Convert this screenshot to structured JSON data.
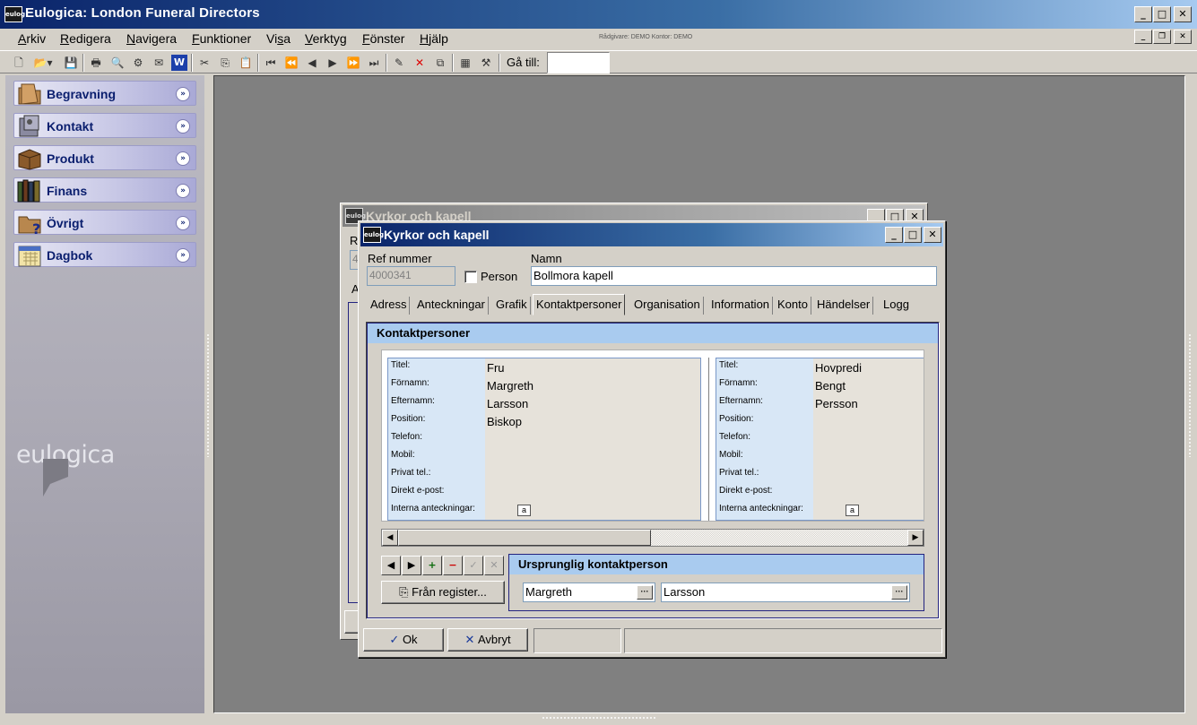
{
  "app": {
    "title": "Eulogica: London Funeral Directors",
    "icon": "eulogica-app-icon",
    "icon_text": "eulog"
  },
  "menu": {
    "items": [
      {
        "pre": "",
        "u": "A",
        "post": "rkiv"
      },
      {
        "pre": "",
        "u": "R",
        "post": "edigera"
      },
      {
        "pre": "",
        "u": "N",
        "post": "avigera"
      },
      {
        "pre": "",
        "u": "F",
        "post": "unktioner"
      },
      {
        "pre": "Vi",
        "u": "s",
        "post": "a"
      },
      {
        "pre": "",
        "u": "V",
        "post": "erktyg"
      },
      {
        "pre": "",
        "u": "F",
        "post": "önster"
      },
      {
        "pre": "",
        "u": "H",
        "post": "jälp"
      }
    ],
    "info": "Rådgivare: DEMO   Kontor: DEMO"
  },
  "toolbar": {
    "goto_label": "Gå till:",
    "goto_value": ""
  },
  "sidebar": {
    "items": [
      {
        "label": "Begravning",
        "icon": "folder-icon"
      },
      {
        "label": "Kontakt",
        "icon": "contact-card-icon"
      },
      {
        "label": "Produkt",
        "icon": "box-icon"
      },
      {
        "label": "Finans",
        "icon": "ledger-books-icon"
      },
      {
        "label": "Övrigt",
        "icon": "folder-question-icon"
      },
      {
        "label": "Dagbok",
        "icon": "calendar-icon"
      }
    ],
    "chevron": "»",
    "logo_text": "eulogica"
  },
  "bg_dialog": {
    "title": "Kyrkor och kapell",
    "fragment_r": "R",
    "fragment_4": "4",
    "fragment_a": "A"
  },
  "dialog": {
    "title": "Kyrkor och kapell",
    "ref_label": "Ref nummer",
    "ref_value": "4000341",
    "person_label": "Person",
    "person_checked": false,
    "name_label": "Namn",
    "name_value": "Bollmora kapell",
    "tabs": [
      "Adress",
      "Anteckningar",
      "Grafik",
      "Kontaktpersoner",
      "Organisation",
      "Information",
      "Konto",
      "Händelser",
      "Logg"
    ],
    "active_tab": "Kontaktpersoner",
    "group_title": "Kontaktpersoner",
    "field_labels": [
      "Titel:",
      "Förnamn:",
      "Efternamn:",
      "Position:",
      "Telefon:",
      "Mobil:",
      "Privat tel.:",
      "Direkt e-post:",
      "Interna anteckningar:"
    ],
    "contacts": [
      {
        "titel": "Fru",
        "fornamn": "Margreth",
        "efternamn": "Larsson",
        "position": "Biskop"
      },
      {
        "titel": "Hovpredi",
        "fornamn": "Bengt",
        "efternamn": "Persson",
        "position": ""
      }
    ],
    "note_glyph": "a",
    "nav_buttons": [
      "◀",
      "▶",
      "+",
      "−",
      "✓",
      "✕"
    ],
    "from_register_label": "Från register...",
    "original_title": "Ursprunglig kontaktperson",
    "original_first": "Margreth",
    "original_last": "Larsson",
    "ellipsis": "···",
    "ok_label": "Ok",
    "cancel_label": "Avbryt"
  },
  "colors": {
    "title_active": "#0a246a",
    "title_inactive": "#808080",
    "group_header": "#a9cbef",
    "label_column": "#d8e7f6",
    "sidebar_label": "#0a1e6e"
  }
}
